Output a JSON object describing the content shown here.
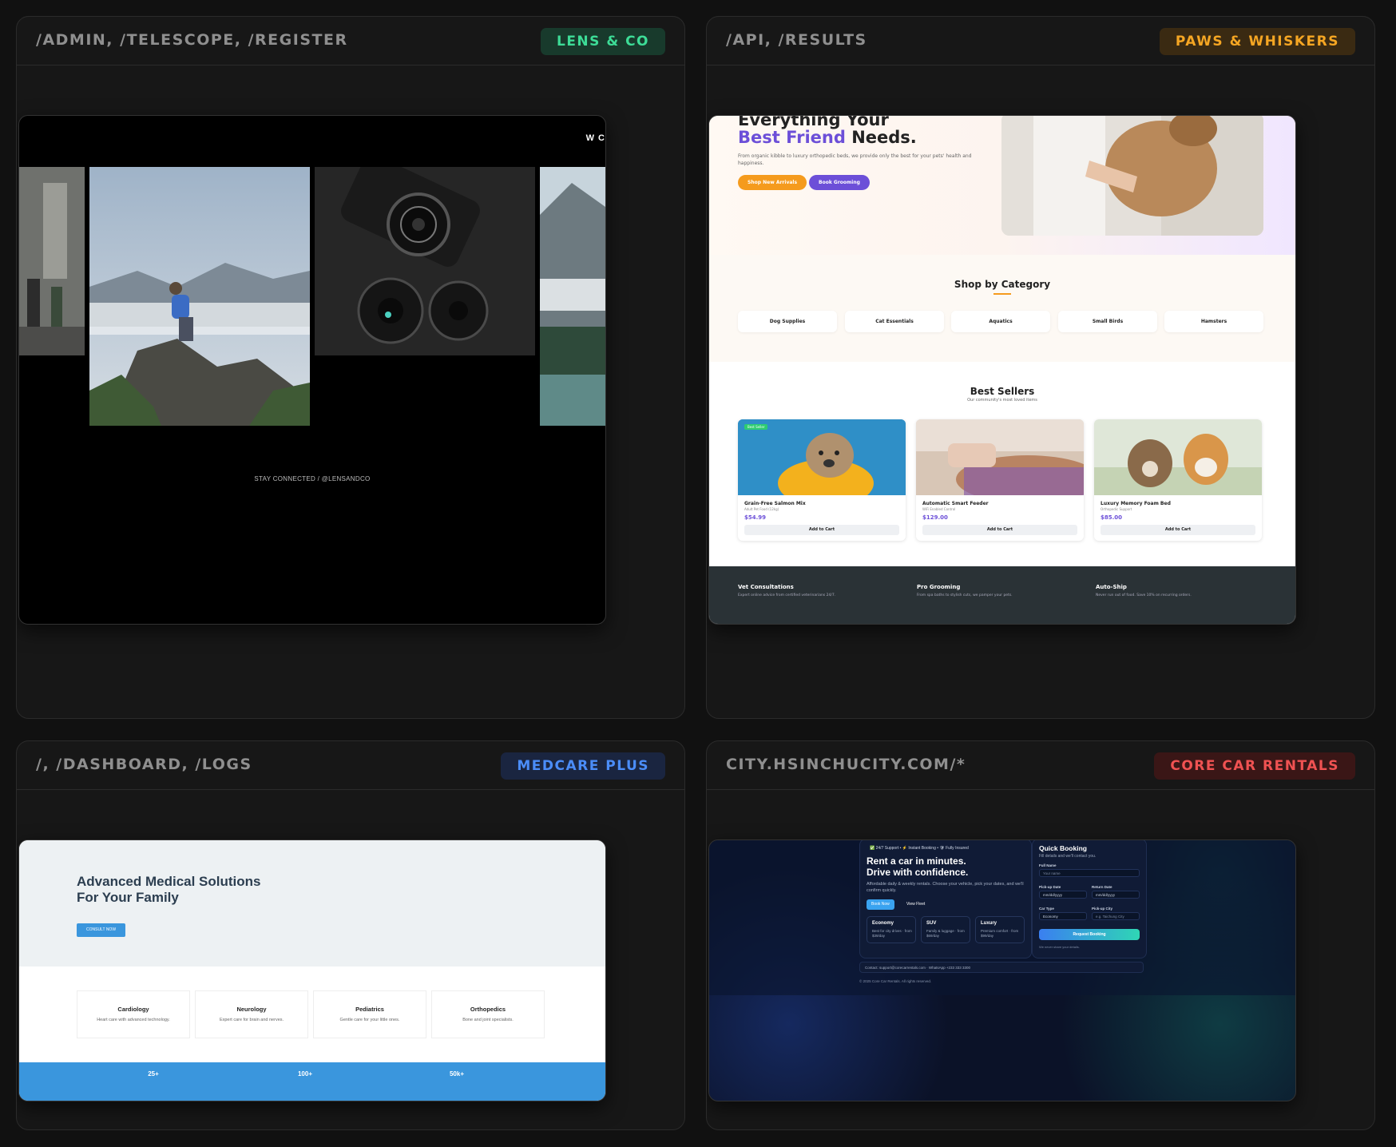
{
  "panels": [
    {
      "route": "/ADMIN, /TELESCOPE, /REGISTER",
      "badge": "LENS & CO",
      "badge_color": "#3ddc97",
      "badge_bg": "#183a2c"
    },
    {
      "route": "/API, /RESULTS",
      "badge": "PAWS & WHISKERS",
      "badge_color": "#f5a623",
      "badge_bg": "#3a2a12"
    },
    {
      "route": "/, /DASHBOARD, /LOGS",
      "badge": "MEDCARE PLUS",
      "badge_color": "#4b8df8",
      "badge_bg": "#1a2540"
    },
    {
      "route": "CITY.HSINCHUCITY.COM/*",
      "badge": "CORE CAR RENTALS",
      "badge_color": "#f05252",
      "badge_bg": "#3a1616"
    }
  ],
  "lens": {
    "corner_text": "W C",
    "follow_text": "STAY CONNECTED / @LENSANDCO"
  },
  "paws": {
    "hero_line1": "Everything Your",
    "hero_accent": "Best Friend",
    "hero_rest": " Needs.",
    "hero_desc": "From organic kibble to luxury orthopedic beds, we provide only the best for your pets' health and happiness.",
    "btn_shop": "Shop New Arrivals",
    "btn_groom": "Book Grooming",
    "categories_title": "Shop by Category",
    "categories": [
      "Dog Supplies",
      "Cat Essentials",
      "Aquatics",
      "Small Birds",
      "Hamsters"
    ],
    "bestsellers_title": "Best Sellers",
    "bestsellers_sub": "Our community's most loved items",
    "products": [
      {
        "name": "Grain-Free Salmon Mix",
        "sub": "Adult Pet Food (12kg)",
        "price": "$54.99",
        "cta": "Add to Cart",
        "tag": "Best Seller"
      },
      {
        "name": "Automatic Smart Feeder",
        "sub": "WiFi Enabled Control",
        "price": "$129.00",
        "cta": "Add to Cart",
        "tag": ""
      },
      {
        "name": "Luxury Memory Foam Bed",
        "sub": "Orthopedic Support",
        "price": "$85.00",
        "cta": "Add to Cart",
        "tag": ""
      }
    ],
    "features": [
      {
        "title": "Vet Consultations",
        "desc": "Expert online advice from certified veterinarians 24/7."
      },
      {
        "title": "Pro Grooming",
        "desc": "From spa baths to stylish cuts, we pamper your pets."
      },
      {
        "title": "Auto-Ship",
        "desc": "Never run out of food. Save 10% on recurring orders."
      }
    ]
  },
  "med": {
    "hero_line1": "Advanced Medical Solutions",
    "hero_line2": "For Your Family",
    "consult": "CONSULT NOW",
    "specialties": [
      {
        "title": "Cardiology",
        "desc": "Heart care with advanced technology."
      },
      {
        "title": "Neurology",
        "desc": "Expert care for brain and nerves."
      },
      {
        "title": "Pediatrics",
        "desc": "Gentle care for your little ones."
      },
      {
        "title": "Orthopedics",
        "desc": "Bone and joint specialists."
      }
    ],
    "stats": [
      "25+",
      "100+",
      "50k+"
    ]
  },
  "car": {
    "pills": "✅ 24/7 Support • ⚡ Instant Booking • 🛡 Fully Insured",
    "headline1": "Rent a car in minutes.",
    "headline2": "Drive with confidence.",
    "desc": "Affordable daily & weekly rentals. Choose your vehicle, pick your dates, and we'll confirm quickly.",
    "book_now": "Book Now",
    "view_fleet": "View Fleet",
    "tiers": [
      {
        "title": "Economy",
        "desc": "Best for city drives · from $39/day"
      },
      {
        "title": "SUV",
        "desc": "Family & luggage · from $69/day"
      },
      {
        "title": "Luxury",
        "desc": "Premium comfort · from $99/day"
      }
    ],
    "qb_title": "Quick Booking",
    "qb_sub": "Fill details and we'll contact you.",
    "full_name_label": "Full Name",
    "full_name_ph": "Your name",
    "pickup_date_label": "Pick-up Date",
    "return_date_label": "Return Date",
    "date_ph": "mm/dd/yyyy",
    "car_type_label": "Car Type",
    "car_type_value": "Economy",
    "pickup_city_label": "Pick-up City",
    "pickup_city_ph": "e.g. Taichung City",
    "request": "Request Booking",
    "note": "We never share your details.",
    "contact": "Contact: support@corecarrentals.com · WhatsApp +233 333 3300",
    "copyright": "© 2025 Core Car Rentals. All rights reserved."
  }
}
